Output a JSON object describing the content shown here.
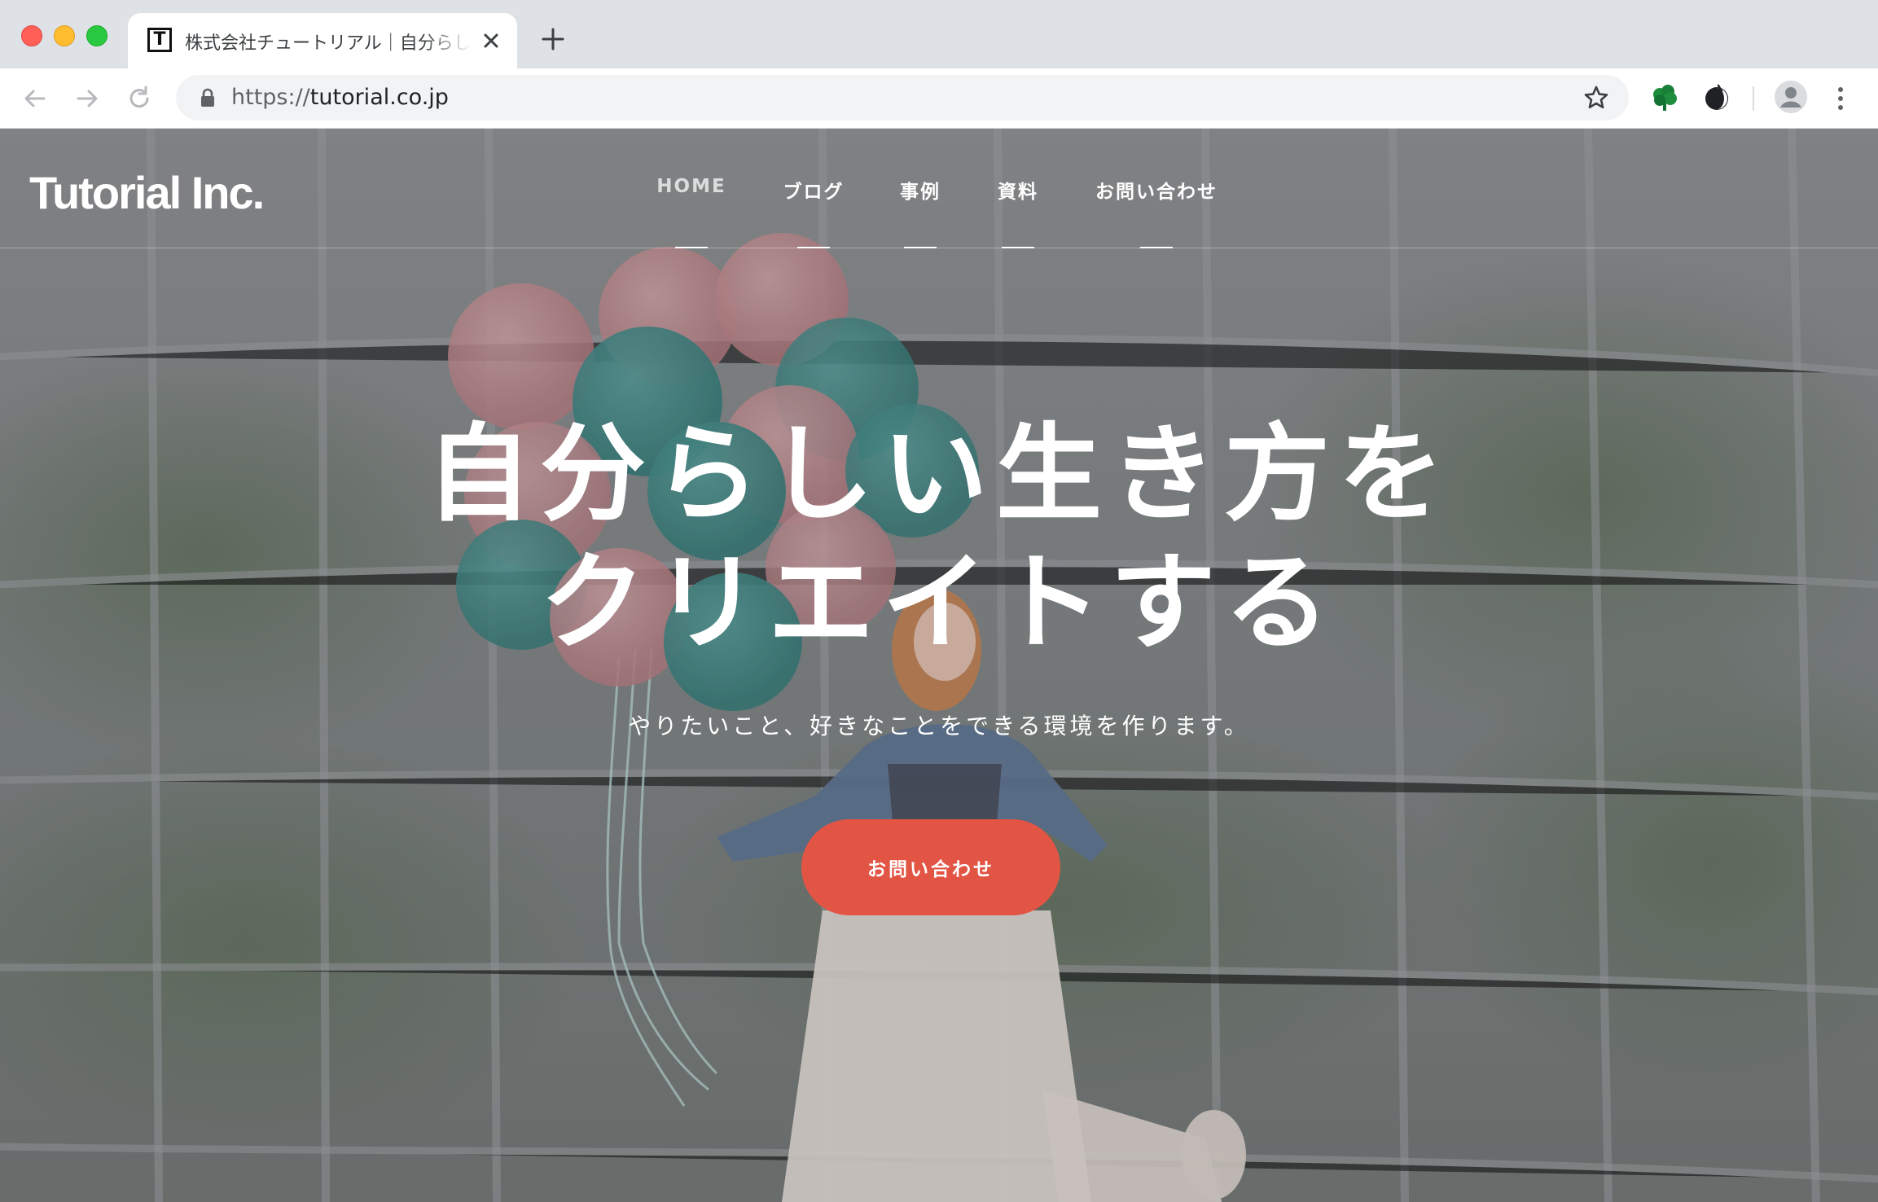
{
  "browser": {
    "tab": {
      "favicon_letter": "T",
      "title": "株式会社チュートリアル｜自分らしい生き方をクリエイトする"
    },
    "url": {
      "scheme": "https://",
      "host": "tutorial.co.jp"
    },
    "icons": [
      "back-arrow-icon",
      "forward-arrow-icon",
      "reload-icon",
      "lock-icon",
      "star-icon",
      "tree-extension-icon",
      "moon-extension-icon",
      "profile-icon",
      "kebab-menu-icon"
    ]
  },
  "site": {
    "logo": "Tutorial Inc.",
    "nav": [
      {
        "label": "HOME",
        "active": true
      },
      {
        "label": "ブログ",
        "active": false
      },
      {
        "label": "事例",
        "active": false
      },
      {
        "label": "資料",
        "active": false
      },
      {
        "label": "お問い合わせ",
        "active": false
      }
    ]
  },
  "hero": {
    "title_line1": "自分らしい生き方を",
    "title_line2": "クリエイトする",
    "subtitle": "やりたいこと、好きなことをできる環境を作ります。",
    "cta_label": "お問い合わせ"
  },
  "colors": {
    "cta": "#e25444",
    "tab_bar": "#dee1e6",
    "omnibox": "#f1f3f4"
  }
}
